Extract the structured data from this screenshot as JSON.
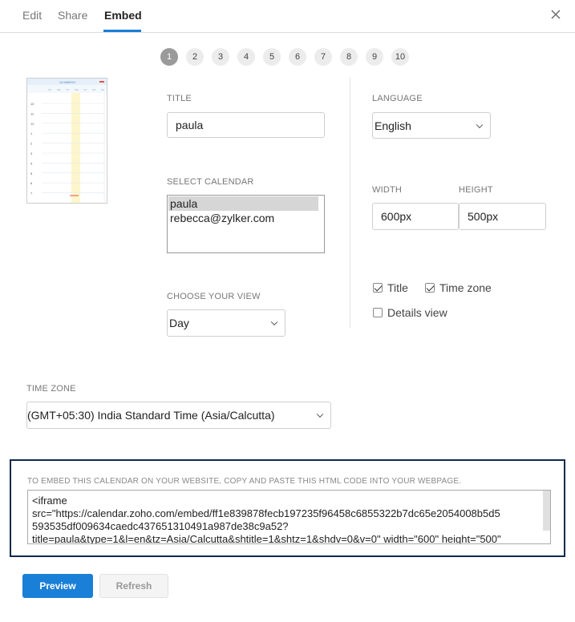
{
  "tabs": [
    {
      "label": "Edit",
      "active": false
    },
    {
      "label": "Share",
      "active": false
    },
    {
      "label": "Embed",
      "active": true
    }
  ],
  "steps": [
    "1",
    "2",
    "3",
    "4",
    "5",
    "6",
    "7",
    "8",
    "9",
    "10"
  ],
  "active_step": "1",
  "title_field": {
    "label": "TITLE",
    "value": "paula"
  },
  "calendar_select": {
    "label": "SELECT CALENDAR",
    "items": [
      "paula",
      "rebecca@zylker.com"
    ],
    "selected": "paula"
  },
  "view_select": {
    "label": "CHOOSE YOUR VIEW",
    "value": "Day"
  },
  "language_select": {
    "label": "LANGUAGE",
    "value": "English"
  },
  "width_field": {
    "label": "WIDTH",
    "value": "600px"
  },
  "height_field": {
    "label": "HEIGHT",
    "value": "500px"
  },
  "options": {
    "title": {
      "label": "Title",
      "checked": true
    },
    "time_zone": {
      "label": "Time zone",
      "checked": true
    },
    "details_view": {
      "label": "Details view",
      "checked": false
    }
  },
  "timezone_select": {
    "label": "TIME ZONE",
    "value": "(GMT+05:30) India Standard Time (Asia/Calcutta)"
  },
  "embed": {
    "hint": "TO EMBED THIS CALENDAR ON YOUR WEBSITE, COPY AND PASTE THIS HTML CODE INTO YOUR WEBPAGE.",
    "code_lines": [
      "<iframe",
      "src=\"https://calendar.zoho.com/embed/ff1e839878fecb197235f96458c6855322b7dc65e2054008b5d5",
      "593535df009634caedc437651310491a987de38c9a52?",
      "title=paula&type=1&l=en&tz=Asia/Calcutta&shtitle=1&shtz=1&shdv=0&v=0\" width=\"600\" height=\"500\""
    ]
  },
  "buttons": {
    "preview": "Preview",
    "refresh": "Refresh"
  },
  "thumbnail": {
    "header": "14 MARCH",
    "hours": [
      "10",
      "11",
      "12",
      "1",
      "2",
      "3",
      "4",
      "5",
      "6",
      "7"
    ],
    "day_cols": [
      "SU",
      "MO",
      "TU",
      "WE",
      "TH",
      "FR",
      "SA"
    ]
  },
  "colors": {
    "accent": "#1a7fd6",
    "embed_border": "#0d2a4a",
    "today_column": "#fdf6cc",
    "now_line": "#e05050"
  }
}
